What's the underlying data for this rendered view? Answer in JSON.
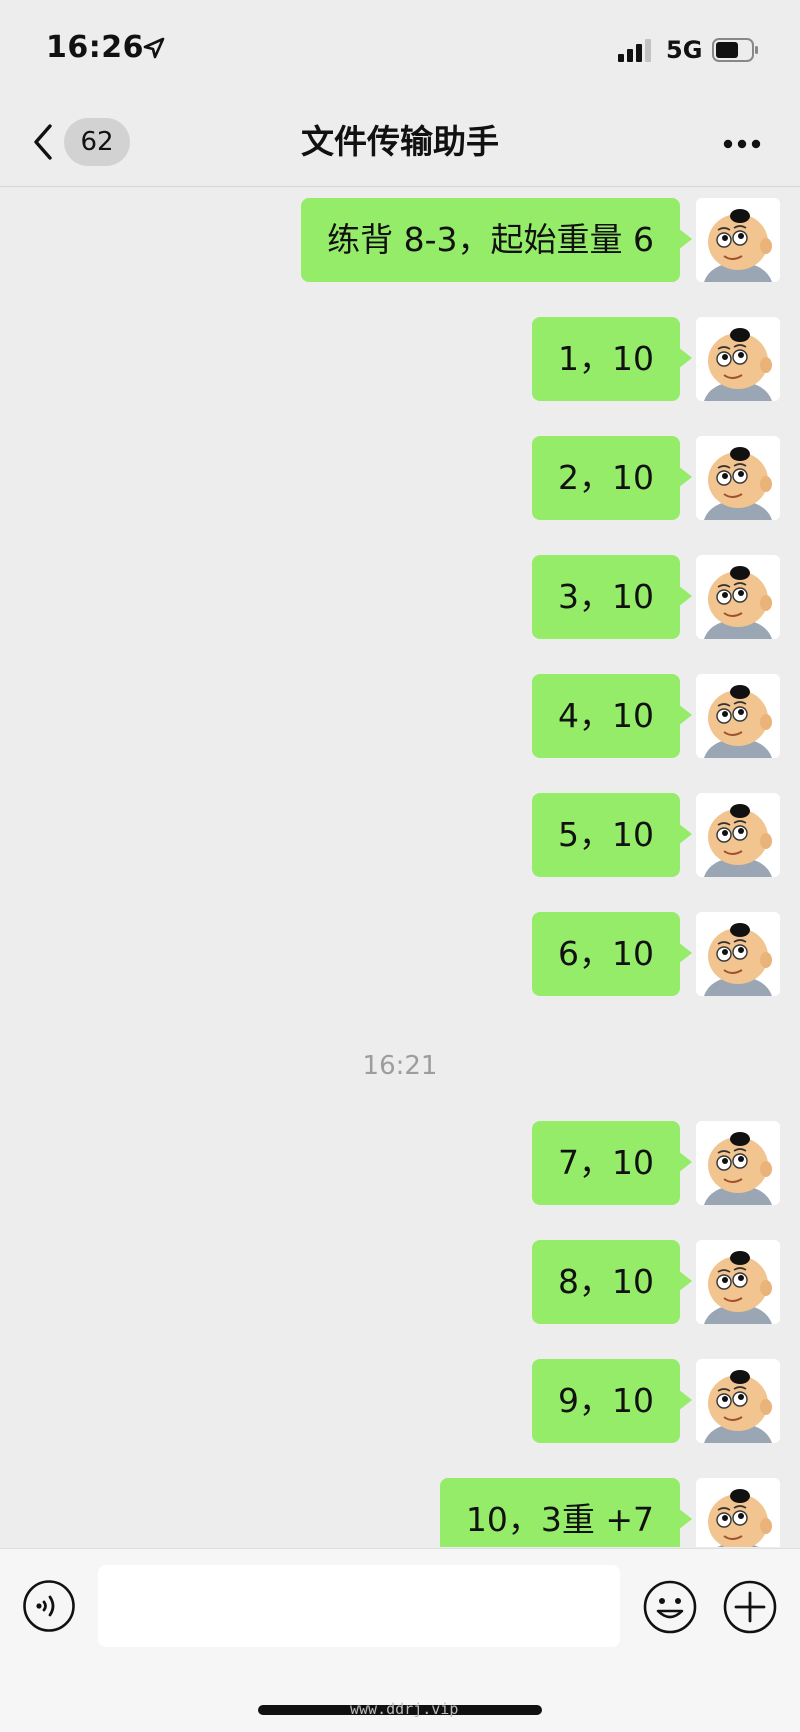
{
  "status": {
    "time": "16:26",
    "network": "5G"
  },
  "nav": {
    "back_badge": "62",
    "title": "文件传输助手"
  },
  "messages": [
    {
      "text": "练背 8-3，起始重量 6"
    },
    {
      "text": "1，10"
    },
    {
      "text": "2，10"
    },
    {
      "text": "3，10"
    },
    {
      "text": "4，10"
    },
    {
      "text": "5，10"
    },
    {
      "text": "6，10"
    },
    {
      "text": "7，10"
    },
    {
      "text": "8，10"
    },
    {
      "text": "9，10"
    },
    {
      "text": "10，3重 +7"
    }
  ],
  "timestamp": "16:21",
  "input": {
    "value": "",
    "placeholder": ""
  },
  "icons": {
    "back": "chevron-left-icon",
    "more": "ellipsis-icon",
    "voice": "voice-icon",
    "emoji": "smiley-icon",
    "plus": "plus-icon"
  },
  "colors": {
    "bubble": "#95ec69",
    "background": "#ededed"
  },
  "watermark": "www.ddrj.vip"
}
